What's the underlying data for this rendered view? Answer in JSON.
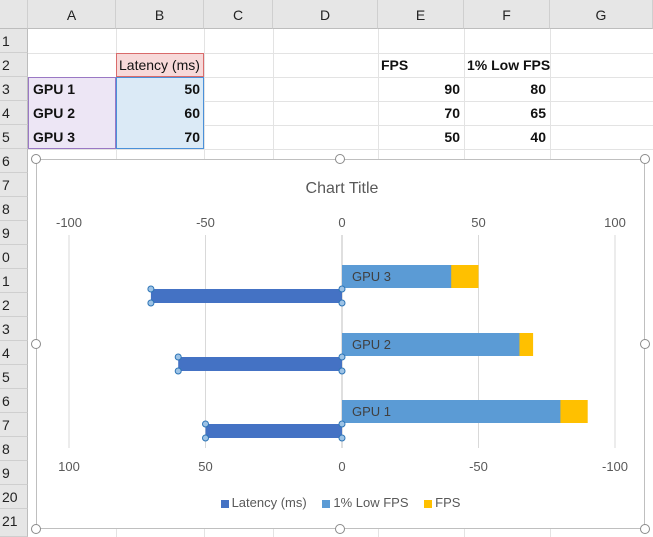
{
  "columns": [
    "A",
    "B",
    "C",
    "D",
    "E",
    "F",
    "G"
  ],
  "rows": [
    "1",
    "2",
    "3",
    "4",
    "5",
    "6",
    "7",
    "8",
    "9",
    "0",
    "1",
    "2",
    "3",
    "4",
    "5",
    "6",
    "7",
    "8",
    "9",
    "20",
    "21"
  ],
  "cells": {
    "b2": "Latency (ms)",
    "e2": "FPS",
    "f2": "1% Low FPS",
    "a3": "GPU 1",
    "b3": "50",
    "e3": "90",
    "f3": "80",
    "a4": "GPU 2",
    "b4": "60",
    "e4": "70",
    "f4": "65",
    "a5": "GPU 3",
    "b5": "70",
    "e5": "50",
    "f5": "40"
  },
  "chart_data": {
    "type": "bar",
    "orientation": "horizontal",
    "title": "Chart Title",
    "categories": [
      "GPU 3",
      "GPU 2",
      "GPU 1"
    ],
    "series": [
      {
        "name": "Latency (ms)",
        "values": [
          70,
          60,
          50
        ],
        "direction": "left",
        "color": "#4472c4"
      },
      {
        "name": "1% Low FPS",
        "values": [
          40,
          65,
          80
        ],
        "direction": "right",
        "color": "#5b9bd5"
      },
      {
        "name": "FPS",
        "values": [
          50,
          70,
          90
        ],
        "direction": "right",
        "color": "#ffc000"
      }
    ],
    "top_axis_ticks": [
      "-100",
      "-50",
      "0",
      "50",
      "100"
    ],
    "bottom_axis_ticks": [
      "100",
      "50",
      "0",
      "-50",
      "-100"
    ],
    "xlim": [
      -100,
      100
    ],
    "grid": true,
    "legend_position": "bottom"
  }
}
